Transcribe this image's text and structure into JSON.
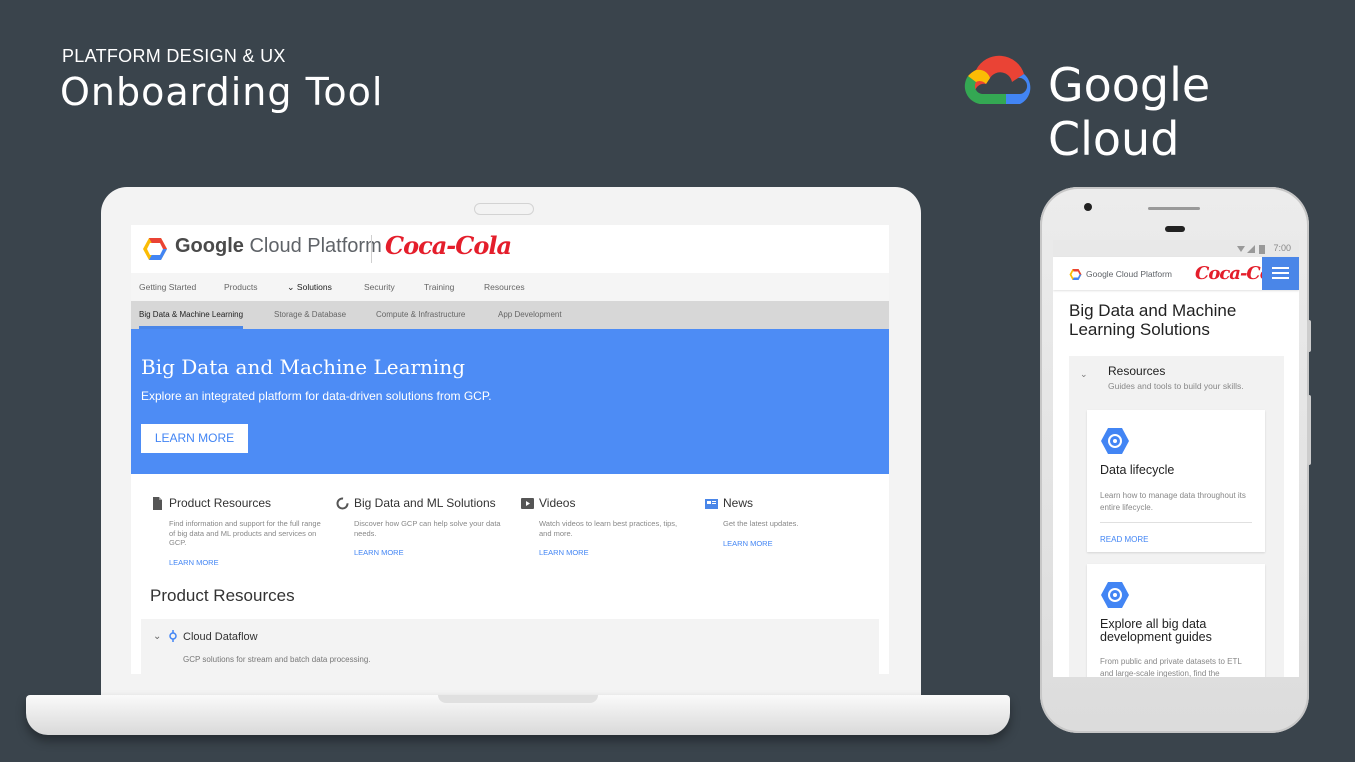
{
  "header": {
    "kicker": "PLATFORM DESIGN & UX",
    "title": "Onboarding Tool",
    "brand": "Google Cloud"
  },
  "desktop": {
    "brand": {
      "google": "Google",
      "rest": " Cloud Platform",
      "partner": "Coca-Cola"
    },
    "nav": [
      "Getting Started",
      "Products",
      "Solutions",
      "Security",
      "Training",
      "Resources"
    ],
    "subnav": [
      "Big Data & Machine Learning",
      "Storage & Database",
      "Compute & Infrastructure",
      "App Development"
    ],
    "hero": {
      "title": "Big Data and Machine Learning",
      "subtitle": "Explore an integrated platform for data-driven solutions from GCP.",
      "button": "LEARN MORE"
    },
    "features": [
      {
        "title": "Product Resources",
        "desc": "Find information and support for the full range of big data and ML products and services on GCP.",
        "link": "LEARN MORE"
      },
      {
        "title": "Big Data and ML Solutions",
        "desc": "Discover how GCP can help solve your data needs.",
        "link": "LEARN MORE"
      },
      {
        "title": "Videos",
        "desc": "Watch videos to learn best practices, tips, and more.",
        "link": "LEARN MORE"
      },
      {
        "title": "News",
        "desc": "Get the latest updates.",
        "link": "LEARN MORE"
      }
    ],
    "section_title": "Product Resources",
    "accordion": {
      "title": "Cloud Dataflow",
      "desc": "GCP solutions for stream and batch data processing."
    }
  },
  "mobile": {
    "time": "7:00",
    "brand": "Google Cloud Platform",
    "partner": "Coca-Cola",
    "title": "Big Data and Machine Learning Solutions",
    "resources": {
      "title": "Resources",
      "subtitle": "Guides and tools to build your skills."
    },
    "cards": [
      {
        "title": "Data lifecycle",
        "desc": "Learn how to manage data throughout its entire lifecycle.",
        "link": "READ MORE"
      },
      {
        "title": "Explore all big data development guides",
        "desc": "From public and private datasets to ETL and large-scale ingestion, find the"
      }
    ]
  },
  "colors": {
    "background": "#3a444c",
    "accent": "#4d8cf5",
    "link": "#4285f4",
    "partner": "#e41e2b"
  }
}
